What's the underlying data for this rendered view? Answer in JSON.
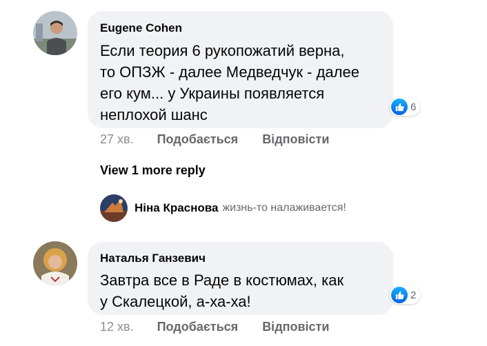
{
  "colors": {
    "bubble": "#f0f2f5",
    "meta_text": "#65676b",
    "like_blue": "#0866ff"
  },
  "comments": [
    {
      "author": "Eugene Cohen",
      "text": "Если теория 6 рукопожатий верна,\nто ОПЗЖ - далее Медведчук - далее\nего кум... у Украины появляется\nнеплохой шанс",
      "reaction_icon": "like-icon",
      "reaction_count": "6",
      "time": "27 хв.",
      "like_label": "Подобається",
      "reply_label": "Відповісти"
    },
    {
      "author": "Наталья Ганзевич",
      "text": "Завтра все в Раде в костюмах, как\nу Скалецкой, а-ха-ха!",
      "reaction_icon": "like-icon",
      "reaction_count": "2",
      "time": "12 хв.",
      "like_label": "Подобається",
      "reply_label": "Відповісти"
    }
  ],
  "more_replies": {
    "label": "View 1 more reply"
  },
  "reply_preview": {
    "author": "Ніна Краснова",
    "snippet": "жизнь-то налаживается!"
  }
}
